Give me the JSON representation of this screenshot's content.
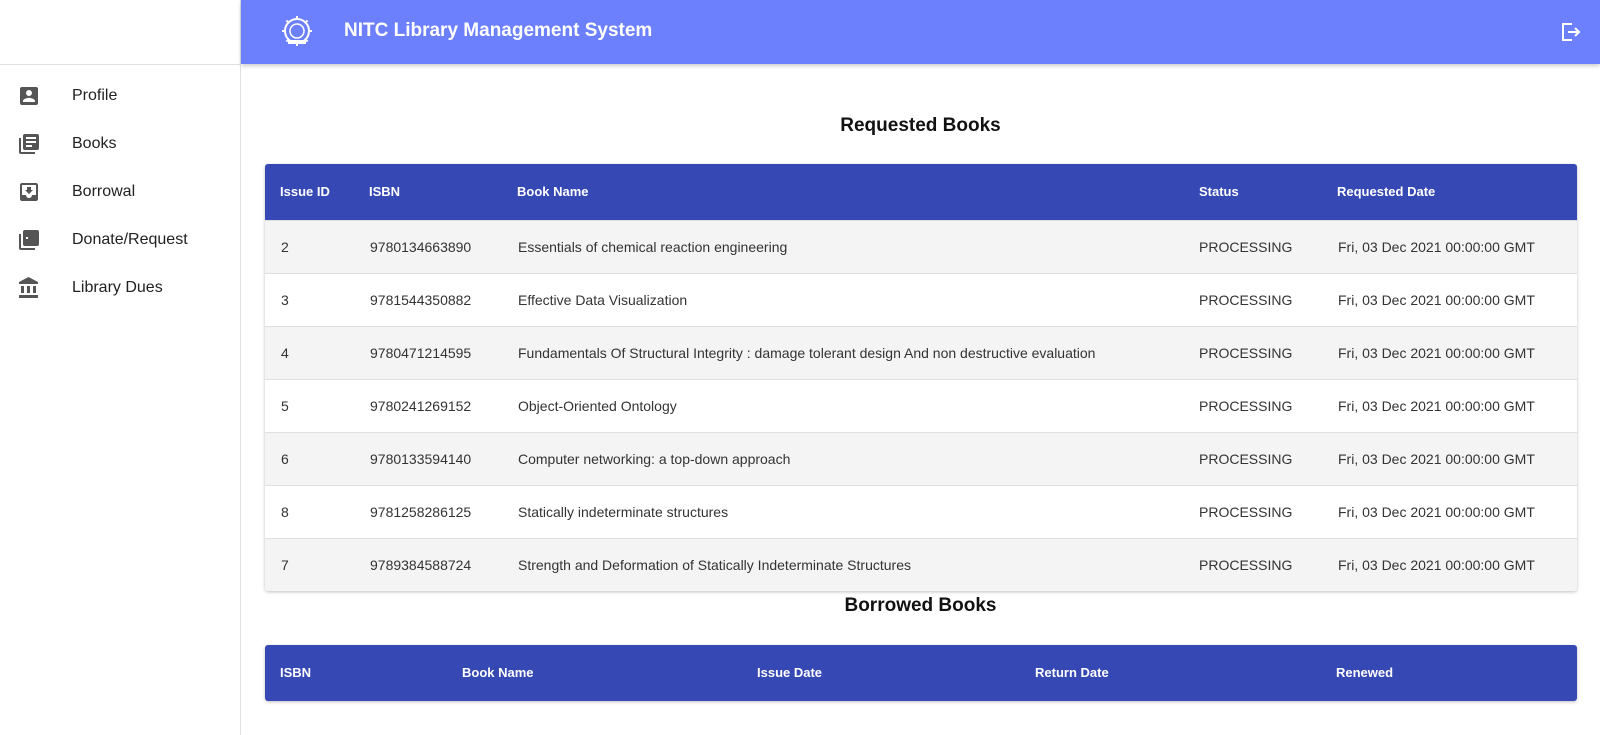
{
  "header": {
    "title": "NITC Library Management System",
    "logo_icon": "institute-emblem-icon",
    "logout_icon": "logout-icon",
    "color": "#6c7ffd"
  },
  "sidebar": {
    "items": [
      {
        "label": "Profile",
        "icon": "account-box-icon"
      },
      {
        "label": "Books",
        "icon": "library-books-icon"
      },
      {
        "label": "Borrowal",
        "icon": "move-to-inbox-icon"
      },
      {
        "label": "Donate/Request",
        "icon": "library-add-icon"
      },
      {
        "label": "Library Dues",
        "icon": "bank-icon"
      }
    ]
  },
  "requested": {
    "title": "Requested Books",
    "header_color": "#3548b4",
    "columns": [
      "Issue ID",
      "ISBN",
      "Book Name",
      "Status",
      "Requested Date"
    ],
    "rows": [
      {
        "id": "2",
        "isbn": "9780134663890",
        "name": "Essentials of chemical reaction engineering",
        "status": "PROCESSING",
        "date": "Fri, 03 Dec 2021 00:00:00 GMT"
      },
      {
        "id": "3",
        "isbn": "9781544350882",
        "name": "Effective Data Visualization",
        "status": "PROCESSING",
        "date": "Fri, 03 Dec 2021 00:00:00 GMT"
      },
      {
        "id": "4",
        "isbn": "9780471214595",
        "name": "Fundamentals Of Structural Integrity : damage tolerant design And non destructive evaluation",
        "status": "PROCESSING",
        "date": "Fri, 03 Dec 2021 00:00:00 GMT"
      },
      {
        "id": "5",
        "isbn": "9780241269152",
        "name": "Object-Oriented Ontology",
        "status": "PROCESSING",
        "date": "Fri, 03 Dec 2021 00:00:00 GMT"
      },
      {
        "id": "6",
        "isbn": "9780133594140",
        "name": "Computer networking: a top-down approach",
        "status": "PROCESSING",
        "date": "Fri, 03 Dec 2021 00:00:00 GMT"
      },
      {
        "id": "8",
        "isbn": "9781258286125",
        "name": "Statically indeterminate structures",
        "status": "PROCESSING",
        "date": "Fri, 03 Dec 2021 00:00:00 GMT"
      },
      {
        "id": "7",
        "isbn": "9789384588724",
        "name": "Strength and Deformation of Statically Indeterminate Structures",
        "status": "PROCESSING",
        "date": "Fri, 03 Dec 2021 00:00:00 GMT"
      }
    ]
  },
  "borrowed": {
    "title": "Borrowed Books",
    "columns": [
      "ISBN",
      "Book Name",
      "Issue Date",
      "Return Date",
      "Renewed"
    ],
    "rows": []
  }
}
